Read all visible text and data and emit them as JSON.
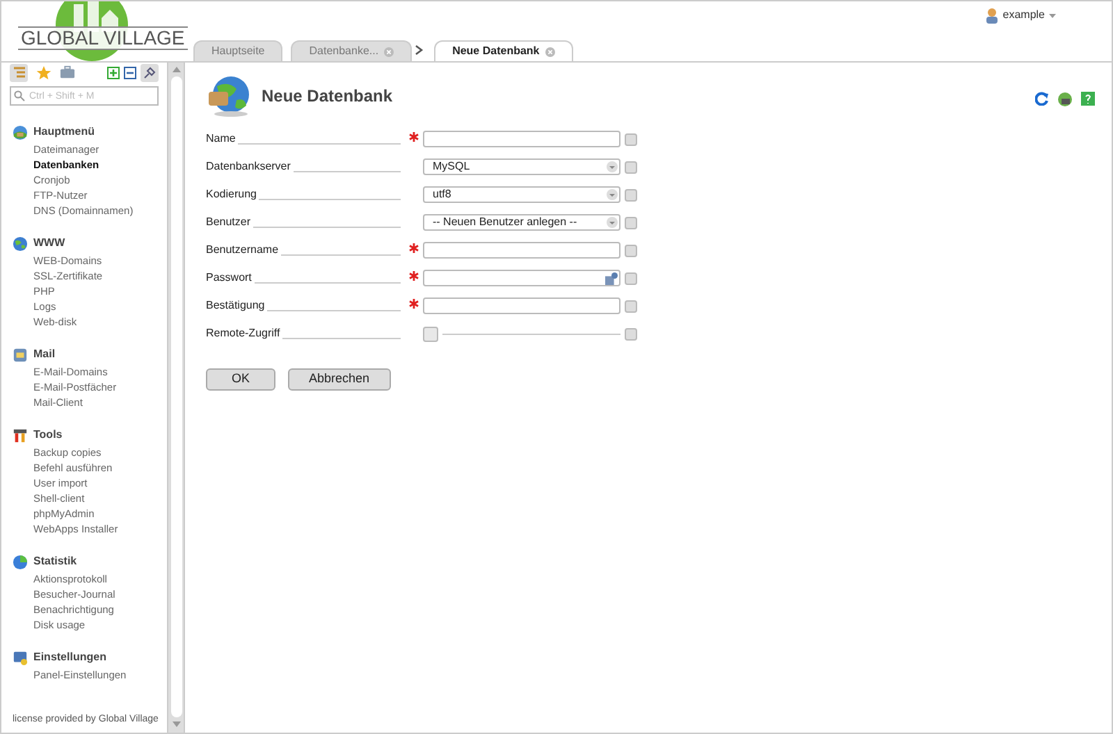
{
  "logo": {
    "text": "GLOBAL VILLAGE"
  },
  "user": {
    "name": "example"
  },
  "tabs": [
    {
      "label": "Hauptseite",
      "selected": false,
      "closable": false
    },
    {
      "label": "Datenbanke...",
      "selected": false,
      "closable": true
    },
    {
      "label": "Neue Datenbank",
      "selected": true,
      "closable": true
    }
  ],
  "search": {
    "placeholder": "Ctrl + Shift + M"
  },
  "sidebar": {
    "sections": [
      {
        "title": "Hauptmenü",
        "items": [
          {
            "label": "Dateimanager",
            "selected": false
          },
          {
            "label": "Datenbanken",
            "selected": true
          },
          {
            "label": "Cronjob",
            "selected": false
          },
          {
            "label": "FTP-Nutzer",
            "selected": false
          },
          {
            "label": "DNS (Domainnamen)",
            "selected": false
          }
        ]
      },
      {
        "title": "WWW",
        "items": [
          {
            "label": "WEB-Domains",
            "selected": false
          },
          {
            "label": "SSL-Zertifikate",
            "selected": false
          },
          {
            "label": "PHP",
            "selected": false
          },
          {
            "label": "Logs",
            "selected": false
          },
          {
            "label": "Web-disk",
            "selected": false
          }
        ]
      },
      {
        "title": "Mail",
        "items": [
          {
            "label": "E-Mail-Domains",
            "selected": false
          },
          {
            "label": "E-Mail-Postfächer",
            "selected": false
          },
          {
            "label": "Mail-Client",
            "selected": false
          }
        ]
      },
      {
        "title": "Tools",
        "items": [
          {
            "label": "Backup copies",
            "selected": false
          },
          {
            "label": "Befehl ausführen",
            "selected": false
          },
          {
            "label": "User import",
            "selected": false
          },
          {
            "label": "Shell-client",
            "selected": false
          },
          {
            "label": "phpMyAdmin",
            "selected": false
          },
          {
            "label": "WebApps Installer",
            "selected": false
          }
        ]
      },
      {
        "title": "Statistik",
        "items": [
          {
            "label": "Aktionsprotokoll",
            "selected": false
          },
          {
            "label": "Besucher-Journal",
            "selected": false
          },
          {
            "label": "Benachrichtigung",
            "selected": false
          },
          {
            "label": "Disk usage",
            "selected": false
          }
        ]
      },
      {
        "title": "Einstellungen",
        "items": [
          {
            "label": "Panel-Einstellungen",
            "selected": false
          }
        ]
      }
    ],
    "footer": "license provided by Global Village"
  },
  "page": {
    "title": "Neue Datenbank"
  },
  "form": {
    "fields": [
      {
        "label": "Name",
        "kind": "text",
        "required": true
      },
      {
        "label": "Datenbankserver",
        "kind": "select",
        "required": false,
        "value": "MySQL"
      },
      {
        "label": "Kodierung",
        "kind": "select",
        "required": false,
        "value": "utf8"
      },
      {
        "label": "Benutzer",
        "kind": "select",
        "required": false,
        "value": "-- Neuen Benutzer anlegen --"
      },
      {
        "label": "Benutzername",
        "kind": "text",
        "required": true
      },
      {
        "label": "Passwort",
        "kind": "password",
        "required": true
      },
      {
        "label": "Bestätigung",
        "kind": "text",
        "required": true
      },
      {
        "label": "Remote-Zugriff",
        "kind": "checkbox",
        "required": false,
        "checked": false
      }
    ],
    "buttons": [
      "OK",
      "Abbrechen"
    ]
  }
}
